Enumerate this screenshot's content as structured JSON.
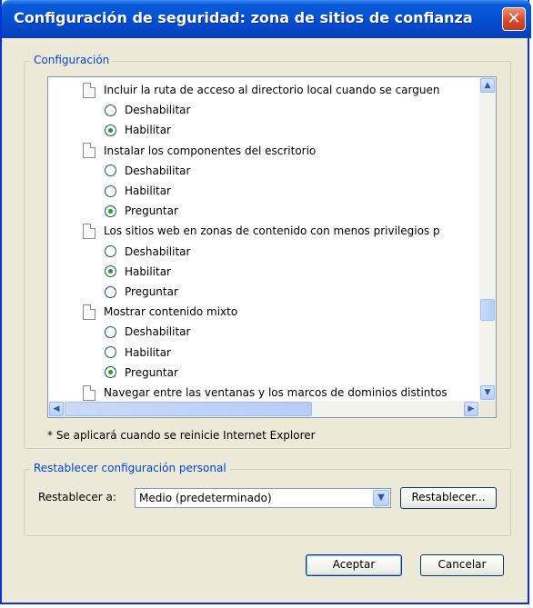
{
  "window": {
    "title": "Configuración de seguridad: zona de sitios de confianza",
    "close_glyph": "✕"
  },
  "settings_group": {
    "legend": "Configuración",
    "items": [
      {
        "type": "header",
        "label": "Incluir la ruta de acceso al directorio local cuando se carguen"
      },
      {
        "type": "option",
        "label": "Deshabilitar",
        "checked": false
      },
      {
        "type": "option",
        "label": "Habilitar",
        "checked": true
      },
      {
        "type": "header",
        "label": "Instalar los componentes del escritorio"
      },
      {
        "type": "option",
        "label": "Deshabilitar",
        "checked": false
      },
      {
        "type": "option",
        "label": "Habilitar",
        "checked": false
      },
      {
        "type": "option",
        "label": "Preguntar",
        "checked": true
      },
      {
        "type": "header",
        "label": "Los sitios web en zonas de contenido con menos privilegios p"
      },
      {
        "type": "option",
        "label": "Deshabilitar",
        "checked": false
      },
      {
        "type": "option",
        "label": "Habilitar",
        "checked": true
      },
      {
        "type": "option",
        "label": "Preguntar",
        "checked": false
      },
      {
        "type": "header",
        "label": "Mostrar contenido mixto"
      },
      {
        "type": "option",
        "label": "Deshabilitar",
        "checked": false
      },
      {
        "type": "option",
        "label": "Habilitar",
        "checked": false
      },
      {
        "type": "option",
        "label": "Preguntar",
        "checked": true
      },
      {
        "type": "header",
        "label": "Navegar entre las ventanas y los marcos de dominios distintos"
      }
    ],
    "note": "* Se aplicará cuando se reinicie Internet Explorer"
  },
  "reset_group": {
    "legend": "Restablecer configuración personal",
    "reset_to_label": "Restablecer a:",
    "selected_level": "Medio (predeterminado)",
    "reset_button": "Restablecer..."
  },
  "footer": {
    "ok_button": "Aceptar",
    "cancel_button": "Cancelar"
  }
}
